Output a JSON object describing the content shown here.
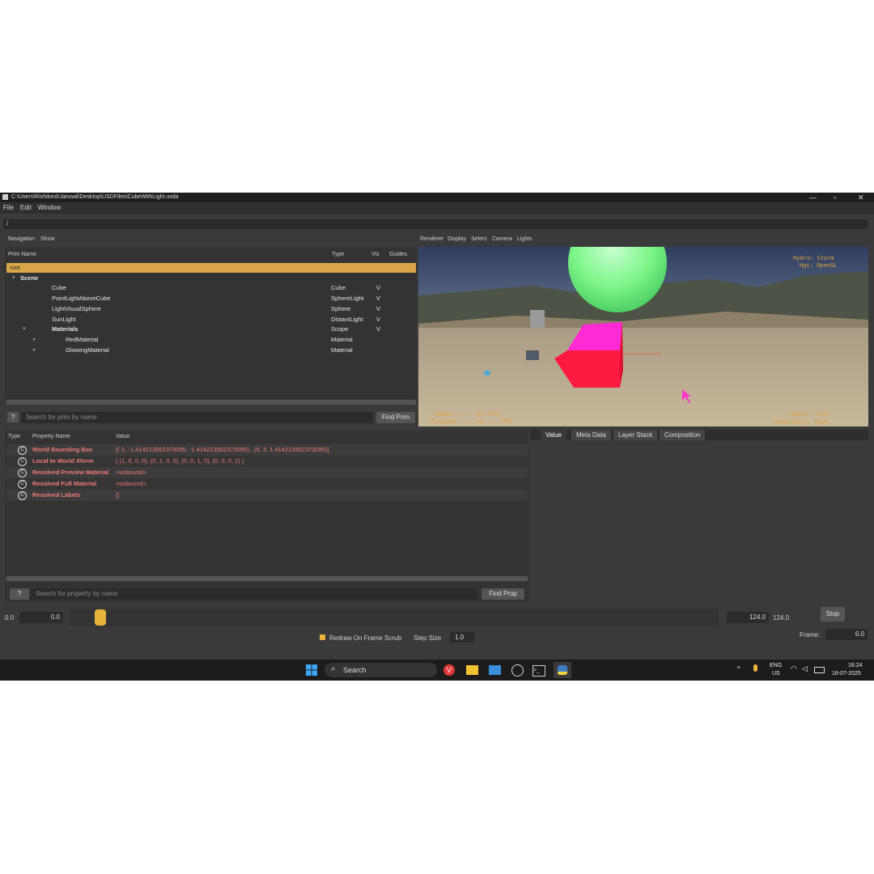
{
  "window": {
    "title": "C:\\Users\\RishikeshJaiswal\\Desktop\\USDFiles\\CubeWithLight.usda",
    "menu": [
      "File",
      "Edit",
      "Window"
    ],
    "path": "/"
  },
  "navigation": {
    "menu": [
      "Navigation",
      "Show"
    ],
    "columns": {
      "name": "Prim Name",
      "type": "Type",
      "vis": "Vis",
      "guides": "Guides"
    },
    "rows": [
      {
        "name": "root",
        "type": "",
        "vis": "",
        "depth": 0,
        "expanded": true,
        "selected": true,
        "bold": false
      },
      {
        "name": "Scene",
        "type": "",
        "vis": "",
        "depth": 1,
        "expanded": true,
        "selected": false,
        "bold": true
      },
      {
        "name": "Cube",
        "type": "Cube",
        "vis": "V",
        "depth": 2,
        "expanded": false,
        "selected": false,
        "bold": false
      },
      {
        "name": "PointLightAboveCube",
        "type": "SphereLight",
        "vis": "V",
        "depth": 2,
        "expanded": false,
        "selected": false,
        "bold": false
      },
      {
        "name": "LightVisualSphere",
        "type": "Sphere",
        "vis": "V",
        "depth": 2,
        "expanded": false,
        "selected": false,
        "bold": false
      },
      {
        "name": "SunLight",
        "type": "DistantLight",
        "vis": "V",
        "depth": 2,
        "expanded": false,
        "selected": false,
        "bold": false
      },
      {
        "name": "Materials",
        "type": "Scope",
        "vis": "V",
        "depth": 2,
        "expanded": true,
        "selected": false,
        "bold": true
      },
      {
        "name": "RedMaterial",
        "type": "Material",
        "vis": "",
        "depth": 3,
        "expanded": false,
        "selected": false,
        "bold": false
      },
      {
        "name": "GlowingMaterial",
        "type": "Material",
        "vis": "",
        "depth": 3,
        "expanded": false,
        "selected": false,
        "bold": false
      }
    ],
    "help_label": "?",
    "search_placeholder": "Search for prim by name",
    "find_button": "Find Prim"
  },
  "viewport": {
    "menu": [
      "Renderer",
      "Display",
      "Select",
      "Camera",
      "Lights"
    ],
    "hud": {
      "top_right": [
        "Hydra: Storm",
        "Hgi: OpenGL"
      ],
      "bottom_right": [
        "Camera: Free",
        "Complexity: High"
      ],
      "bottom_left": [
        "Render: ... inf FPS",
        "Playback: ... ms  ... FPS"
      ]
    },
    "colors": {
      "sphere": "#7ef58a",
      "cube_front": "#ff1a40",
      "cube_top": "#ff2ad4",
      "sand": "#b9a98c",
      "sky": "#3d4a66",
      "cursor": "#ff3cc8"
    }
  },
  "properties": {
    "columns": {
      "type": "Type",
      "name": "Property Name",
      "value": "Value"
    },
    "rows": [
      {
        "icon": "C",
        "name": "World Bounding Box",
        "value": "[(-1, -1.414213562373095, -1.414213562373095)...(5, 3, 1.414213562373095)]"
      },
      {
        "icon": "C",
        "name": "Local to World Xform",
        "value": "( (1, 0, 0, 0), (0, 1, 0, 0), (0, 0, 1, 0), (0, 0, 0, 1) )"
      },
      {
        "icon": "C",
        "name": "Resolved Preview Material",
        "value": "<unbound>"
      },
      {
        "icon": "C",
        "name": "Resolved Full Material",
        "value": "<unbound>"
      },
      {
        "icon": "C",
        "name": "Resolved Labels",
        "value": "[]"
      }
    ],
    "help_label": "?",
    "search_placeholder": "Search for property by name",
    "find_button": "Find Prop"
  },
  "detail_tabs": [
    "Value",
    "Meta Data",
    "Layer Stack",
    "Composition"
  ],
  "timeline": {
    "start": "0.0",
    "start_field": "0.0",
    "end_field": "124.0",
    "end": "124.0",
    "stop_button": "Stop",
    "redraw_label": "Redraw On Frame Scrub",
    "step_label": "Step Size",
    "step_value": "1.0",
    "frame_label": "Frame:",
    "frame_value": "6.0",
    "scrub_fraction": 0.048
  },
  "taskbar": {
    "search_label": "Search",
    "lang": "ENG",
    "region": "US",
    "time": "16:24",
    "date": "16-07-2025"
  }
}
